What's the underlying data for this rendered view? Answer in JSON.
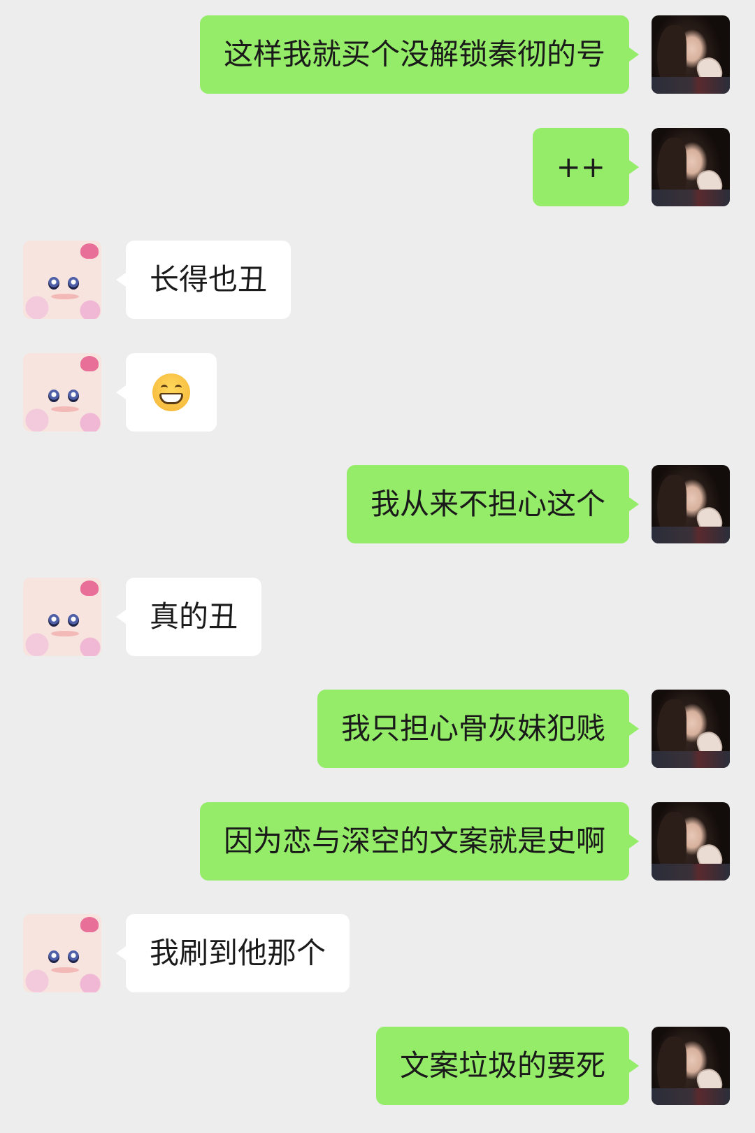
{
  "chat": {
    "messages": [
      {
        "sender": "me",
        "text": "这样我就买个没解锁秦彻的号"
      },
      {
        "sender": "me",
        "text": "++"
      },
      {
        "sender": "other",
        "text": "长得也丑"
      },
      {
        "sender": "other",
        "emoji": "grinning-face-with-smiling-eyes"
      },
      {
        "sender": "me",
        "text": "我从来不担心这个"
      },
      {
        "sender": "other",
        "text": "真的丑"
      },
      {
        "sender": "me",
        "text": "我只担心骨灰妹犯贱"
      },
      {
        "sender": "me",
        "text": "因为恋与深空的文案就是史啊"
      },
      {
        "sender": "other",
        "text": "我刷到他那个"
      },
      {
        "sender": "me",
        "text": "文案垃圾的要死"
      }
    ]
  },
  "colors": {
    "background": "#ededed",
    "my_bubble": "#95ec69",
    "other_bubble": "#ffffff",
    "text": "#1a1a1a"
  }
}
